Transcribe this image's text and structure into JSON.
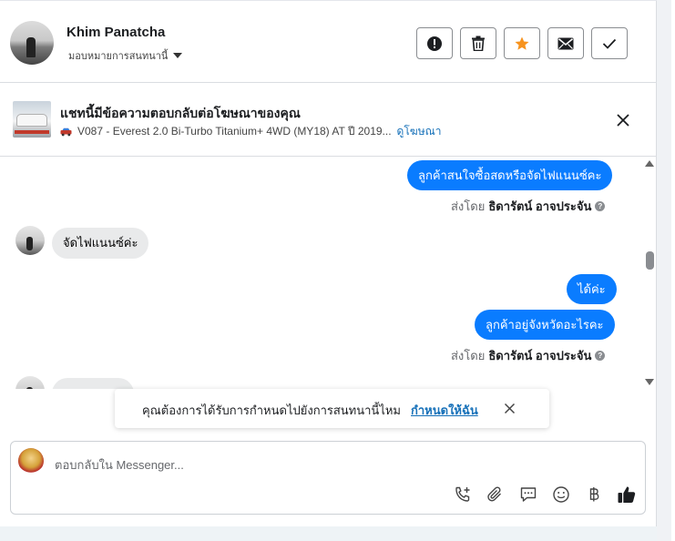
{
  "header": {
    "contact_name": "Khim Panatcha",
    "assign_label": "มอบหมายการสนทนานี้",
    "actions": [
      {
        "name": "report-button",
        "icon": "alert-icon"
      },
      {
        "name": "delete-button",
        "icon": "trash-icon"
      },
      {
        "name": "star-button",
        "icon": "star-icon"
      },
      {
        "name": "mark-unread-button",
        "icon": "envelope-icon"
      },
      {
        "name": "mark-done-button",
        "icon": "check-icon"
      }
    ]
  },
  "ad_banner": {
    "title": "แชทนี้มีข้อความตอบกลับต่อโฆษณาของคุณ",
    "ad_text": "V087 - Everest 2.0 Bi-Turbo Titanium+ 4WD (MY18) AT ปี 2019...",
    "view_ad_link": "ดูโฆษณา"
  },
  "messages": {
    "out_1": "ลูกค้าสนใจซื้อสดหรือจัดไฟแนนซ์คะ",
    "sent_by_prefix": "ส่งโดย",
    "sender_name": "ธิดารัตน์ อาจประจัน",
    "in_1": "จัดไฟแนนซ์ค่ะ",
    "out_2": "ได้ค่ะ",
    "out_3": "ลูกค้าอยู่จังหวัดอะไรคะ"
  },
  "toast": {
    "message": "คุณต้องการได้รับการกำหนดไปยังการสนทนานี้ไหม",
    "action": "กำหนดให้ฉัน"
  },
  "composer": {
    "placeholder": "ตอบกลับใน Messenger..."
  },
  "colors": {
    "accent": "#0a7cff",
    "link": "#1771b9",
    "star": "#f7931e"
  }
}
